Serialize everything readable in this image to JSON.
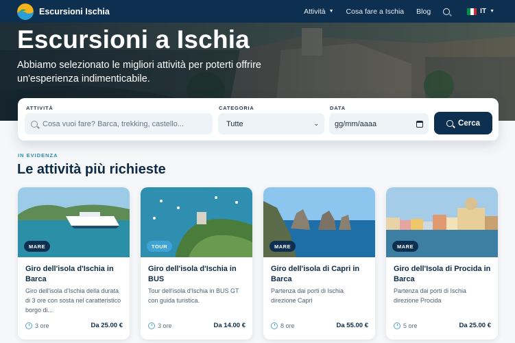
{
  "nav": {
    "brand": "Escursioni Ischia",
    "links": [
      {
        "label": "Attività",
        "has_dropdown": true
      },
      {
        "label": "Cosa fare a Ischia",
        "has_dropdown": false
      },
      {
        "label": "Blog",
        "has_dropdown": false
      }
    ],
    "search_icon": "search-icon",
    "language": "IT",
    "flag_colors": [
      "#009246",
      "#ffffff",
      "#ce2b37"
    ]
  },
  "hero": {
    "title": "Escursioni a Ischia",
    "subtitle": "Abbiamo selezionato le migliori attività per poterti offrire un'esperienza indimenticabile."
  },
  "search": {
    "activity_label": "ATTIVITÀ",
    "activity_placeholder": "Cosa vuoi fare? Barca, trekking, castello...",
    "category_label": "CATEGORIA",
    "category_value": "Tutte",
    "date_label": "DATA",
    "date_placeholder": "gg/mm/aaaa",
    "button_label": "Cerca"
  },
  "featured": {
    "eyebrow": "IN EVIDENZA",
    "title": "Le attività più richieste",
    "cards": [
      {
        "tag": "MARE",
        "tag_color": "#0e3050",
        "title": "Giro dell'isola d'Ischia in Barca",
        "description": "Giro dell'isola d'Ischia della durata di 3 ore con sosta nel caratteristico borgo di...",
        "duration": "3 ore",
        "price": "Da 25.00 €"
      },
      {
        "tag": "TOUR",
        "tag_color": "#3fa3d6",
        "title": "Giro dell'isola d'Ischia in BUS",
        "description": "Tour dell'isola d'Ischia in BUS GT con guida turistica.",
        "duration": "3 ore",
        "price": "Da 14.00 €"
      },
      {
        "tag": "MARE",
        "tag_color": "#0e3050",
        "title": "Giro dell'isola di Capri in Barca",
        "description": "Partenza dai porti di Ischia direzione Capri",
        "duration": "8 ore",
        "price": "Da 55.00 €"
      },
      {
        "tag": "MARE",
        "tag_color": "#0e3050",
        "title": "Giro dell'Isola di Procida in Barca",
        "description": "Partenza dai porti di Ischia direzione Procida",
        "duration": "5 ore",
        "price": "Da 25.00 €"
      }
    ]
  }
}
